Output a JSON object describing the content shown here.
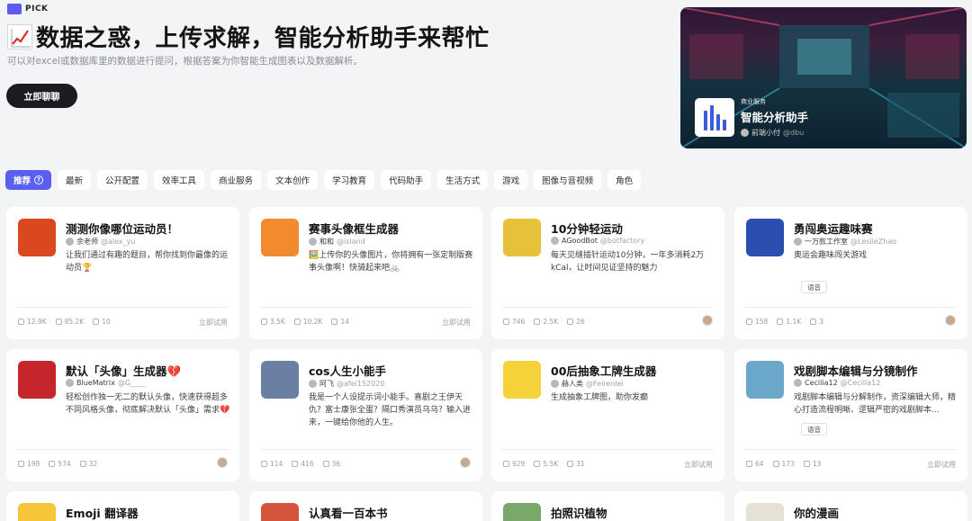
{
  "brand": {
    "text": "PICK"
  },
  "hero": {
    "title": "数据之惑，上传求解，智能分析助手来帮忙",
    "subtitle": "可以对excel或数据库里的数据进行提问，根据答案为你智能生成图表以及数据解析。",
    "cta_label": "立即聊聊",
    "card": {
      "tag": "商业服务",
      "name": "智能分析助手",
      "author": "前端小付",
      "handle": "@dbu"
    }
  },
  "tabs": [
    {
      "label": "推荐",
      "active": true
    },
    {
      "label": "最新"
    },
    {
      "label": "公开配置"
    },
    {
      "label": "效率工具"
    },
    {
      "label": "商业服务"
    },
    {
      "label": "文本创作"
    },
    {
      "label": "学习教育"
    },
    {
      "label": "代码助手"
    },
    {
      "label": "生活方式"
    },
    {
      "label": "游戏"
    },
    {
      "label": "图像与音视频"
    },
    {
      "label": "角色"
    }
  ],
  "cards": [
    {
      "title": "测测你像哪位运动员！",
      "author": "余老师",
      "handle": "@alex_yu",
      "desc": "让我们通过有趣的题目，帮你找到你最像的运动员🏆",
      "chip": "",
      "stats": [
        "12.9K",
        "85.2K",
        "10"
      ],
      "footer": "立即试用",
      "avatar_color": "#d9481f"
    },
    {
      "title": "赛事头像框生成器",
      "author": "和和",
      "handle": "@island",
      "desc": "🖼️上传你的头像图片，你将拥有一张定制版赛事头像啊！快骑起来吧🚲",
      "chip": "",
      "stats": [
        "3.5K",
        "10.2K",
        "14"
      ],
      "footer": "立即试用",
      "avatar_color": "#f28a2e"
    },
    {
      "title": "10分钟轻运动",
      "author": "AGoodBot",
      "handle": "@botfactory",
      "desc": "每天见缝插针运动10分钟，一年多消耗2万kCal，让时间见证坚持的魅力",
      "chip": "",
      "stats": [
        "746",
        "2.5K",
        "26"
      ],
      "footer": "",
      "avatar_color": "#e6c23a"
    },
    {
      "title": "勇闯奥运趣味赛",
      "author": "一万款工作室",
      "handle": "@LeslieZhao",
      "desc": "奥运会趣味闯关游戏",
      "chip": "语音",
      "stats": [
        "158",
        "1.1K",
        "3"
      ],
      "footer": "",
      "avatar_color": "#2a4fb0"
    },
    {
      "title": "默认「头像」生成器💔",
      "author": "BlueMatrix",
      "handle": "@G____",
      "desc": "轻松创作独一无二的默认头像，快速获得超多不同风格头像，彻底解决默认「头像」需求💔",
      "chip": "",
      "stats": [
        "198",
        "574",
        "32"
      ],
      "footer": "",
      "avatar_color": "#c4262b"
    },
    {
      "title": "cos人生小能手",
      "author": "阿飞",
      "handle": "@afei152020",
      "desc": "我是一个人设提示词小能手。喜剧之王伊天仇？富士康张全蛋？隔口秀演员乌乌？输入进来，一键给你他的人生。",
      "chip": "",
      "stats": [
        "114",
        "416",
        "36"
      ],
      "footer": "",
      "avatar_color": "#6b7fa3"
    },
    {
      "title": "00后抽象工牌生成器",
      "author": "赫人类",
      "handle": "@Feirenlei",
      "desc": "生成抽象工牌图，助你发癫",
      "chip": "",
      "stats": [
        "929",
        "5.5K",
        "31"
      ],
      "footer": "立即试用",
      "avatar_color": "#f5d23a"
    },
    {
      "title": "戏剧脚本编辑与分镜制作",
      "author": "Cecilia12",
      "handle": "@Cecilia12",
      "desc": "戏剧脚本编辑与分解制作，资深编辑大师，精心打造流程明晰、逻辑严密的戏剧脚本...",
      "chip": "语音",
      "stats": [
        "64",
        "173",
        "13"
      ],
      "footer": "立即试用",
      "avatar_color": "#6aa7c9"
    },
    {
      "title": "Emoji 翻译器",
      "avatar_color": "#f7c53a"
    },
    {
      "title": "认真看一百本书",
      "avatar_color": "#d4553b"
    },
    {
      "title": "拍照识植物",
      "avatar_color": "#7aa86a"
    },
    {
      "title": "你的漫画",
      "avatar_color": "#e6e1d6"
    }
  ]
}
